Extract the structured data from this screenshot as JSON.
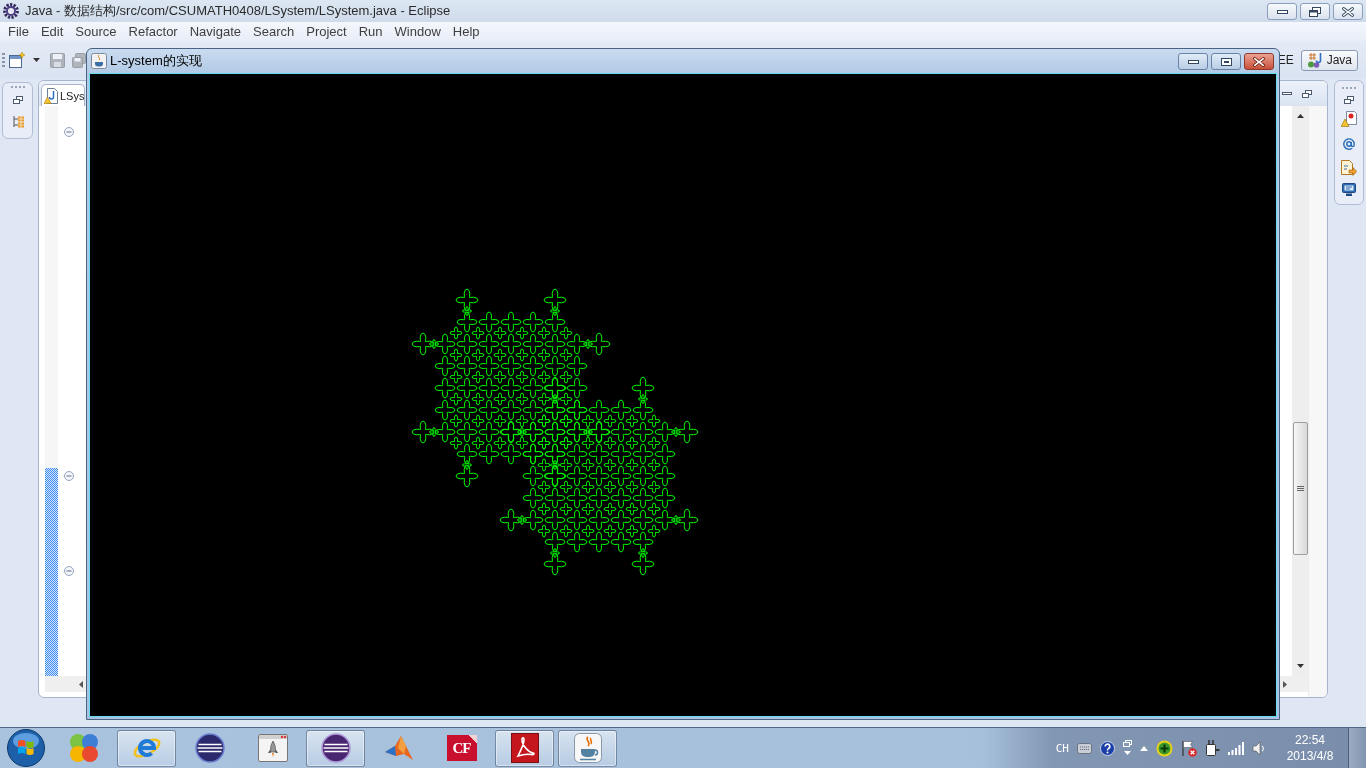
{
  "eclipse": {
    "title": "Java - 数据结构/src/com/CSUMATH0408/LSystem/LSystem.java - Eclipse",
    "menu": [
      "File",
      "Edit",
      "Source",
      "Refactor",
      "Navigate",
      "Search",
      "Project",
      "Run",
      "Window",
      "Help"
    ],
    "toolbar": [
      {
        "kind": "new",
        "disabled": false
      },
      {
        "kind": "save",
        "disabled": true
      },
      {
        "kind": "save_all",
        "disabled": true
      }
    ],
    "perspectives": [
      {
        "label": "EE",
        "selected": false
      },
      {
        "label": "Java",
        "selected": true
      }
    ],
    "editor_tabs": [
      {
        "label": "LSys",
        "selected": true
      }
    ]
  },
  "java_window": {
    "title": "L-system的实现"
  },
  "taskbar": {
    "apps": [
      {
        "kind": "circles",
        "running": false
      },
      {
        "kind": "browser",
        "running": true
      },
      {
        "kind": "sphere",
        "running": false
      },
      {
        "kind": "rocket",
        "running": false
      },
      {
        "kind": "ringed",
        "running": true
      },
      {
        "kind": "peak",
        "running": false
      },
      {
        "kind": "tile",
        "label": "CF",
        "running": false
      },
      {
        "kind": "swirl",
        "running": true
      },
      {
        "kind": "cup",
        "running": true
      }
    ],
    "tray": {
      "language": "CH",
      "time": "22:54",
      "date": "2013/4/8"
    }
  }
}
